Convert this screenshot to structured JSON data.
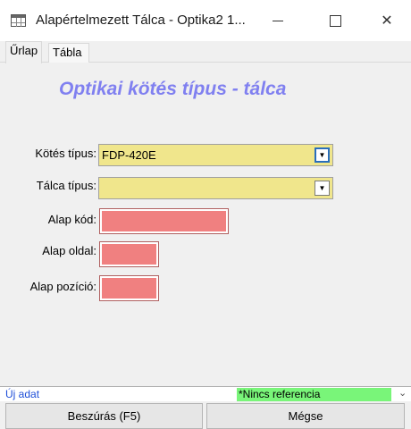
{
  "window": {
    "title": "Alapértelmezett Tálca - Optika2 1...",
    "icon": "table-icon"
  },
  "tabs": [
    {
      "label": "Űrlap",
      "active": true
    },
    {
      "label": "Tábla",
      "active": false
    }
  ],
  "form": {
    "heading": "Optikai kötés típus - tálca",
    "kotes_tipus": {
      "label": "Kötés típus:",
      "value": "FDP-420E"
    },
    "talca_tipus": {
      "label": "Tálca típus:",
      "value": ""
    },
    "alap_kod": {
      "label": "Alap kód:",
      "value": ""
    },
    "alap_oldal": {
      "label": "Alap oldal:",
      "value": ""
    },
    "alap_pozicio": {
      "label": "Alap pozíció:",
      "value": ""
    }
  },
  "status": {
    "left": "Új adat",
    "reference": "*Nincs referencia"
  },
  "buttons": {
    "insert": "Beszúrás (F5)",
    "cancel": "Mégse"
  },
  "colors": {
    "heading": "#8080f0",
    "combo_bg": "#f0e68c",
    "required_field": "#f08080",
    "reference_bg": "#79f579"
  }
}
